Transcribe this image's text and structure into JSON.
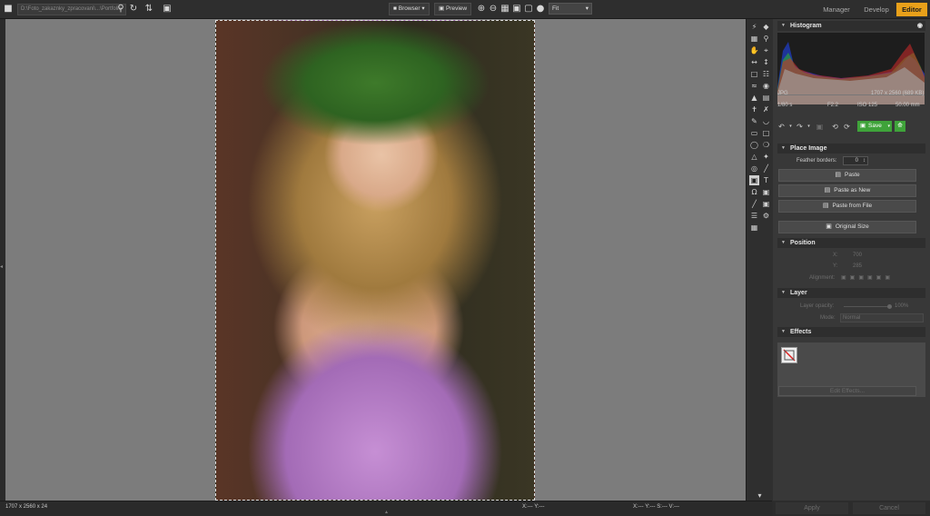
{
  "toolbar": {
    "path_text": "D:\\Foto_zakaznky_zpracovani\\...\\Portfolio",
    "browser_label": "Browser",
    "preview_label": "Preview",
    "zoom_mode": "Fit"
  },
  "modes": {
    "manager": "Manager",
    "develop": "Develop",
    "editor": "Editor"
  },
  "status": {
    "dimensions": "1707 x 2560 x 24",
    "xy_readout": "X:--- Y:---",
    "sv_readout": "X:--- Y:--- S:--- V:---"
  },
  "histogram": {
    "title": "Histogram",
    "format": "JPG",
    "size_info": "1707 x 2560 (689 KB)",
    "shutter": "1/80 s",
    "aperture": "F2.2",
    "iso": "ISO 125",
    "focal": "50.00 mm"
  },
  "actions": {
    "save_label": "Save"
  },
  "place_image": {
    "title": "Place Image",
    "feather_label": "Feather borders:",
    "feather_value": "0",
    "paste_label": "Paste",
    "paste_new_label": "Paste as New",
    "paste_file_label": "Paste from File",
    "original_size_label": "Original Size"
  },
  "position": {
    "title": "Position",
    "x_label": "X:",
    "x_value": "700",
    "y_label": "Y:",
    "y_value": "285",
    "alignment_label": "Alignment:"
  },
  "layer": {
    "title": "Layer",
    "opacity_label": "Layer opacity:",
    "opacity_value": "100%",
    "mode_label": "Mode:",
    "mode_value": "Normal"
  },
  "effects": {
    "title": "Effects",
    "edit_label": "Edit Effects..."
  },
  "footer": {
    "apply_label": "Apply",
    "cancel_label": "Cancel"
  },
  "colors": {
    "accent": "#e8a01a",
    "save_green": "#3fa33a",
    "canvas_gray": "#7c7c7c"
  }
}
